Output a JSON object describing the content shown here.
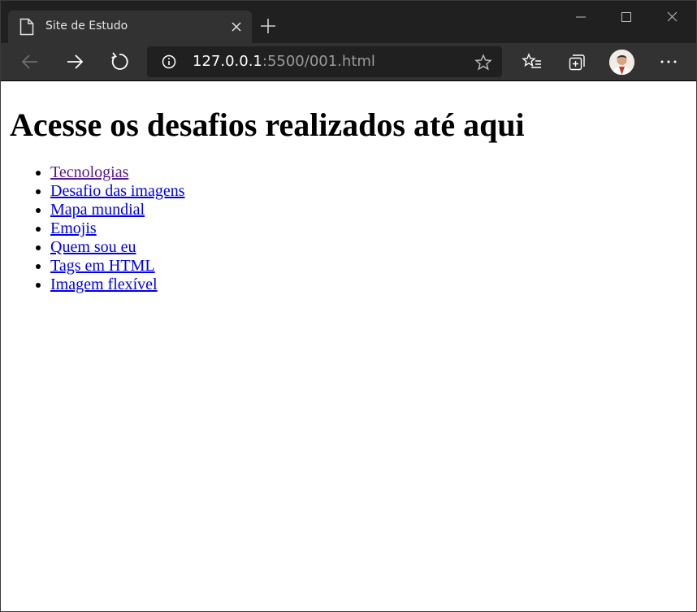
{
  "browser": {
    "tab": {
      "title": "Site de Estudo"
    },
    "address": {
      "host": "127.0.0.1",
      "rest": ":5500/001.html"
    }
  },
  "page": {
    "heading": "Acesse os desafios realizados até aqui",
    "links": [
      {
        "label": "Tecnologias",
        "visited": true
      },
      {
        "label": "Desafio das imagens",
        "visited": false
      },
      {
        "label": "Mapa mundial",
        "visited": false
      },
      {
        "label": "Emojis",
        "visited": false
      },
      {
        "label": "Quem sou eu",
        "visited": false
      },
      {
        "label": "Tags em HTML",
        "visited": false
      },
      {
        "label": "Imagem flexível",
        "visited": false
      }
    ]
  },
  "colors": {
    "link": "#0000ee",
    "visited_link": "#551a8b",
    "chrome_dark": "#202020",
    "chrome_tab": "#323232"
  }
}
